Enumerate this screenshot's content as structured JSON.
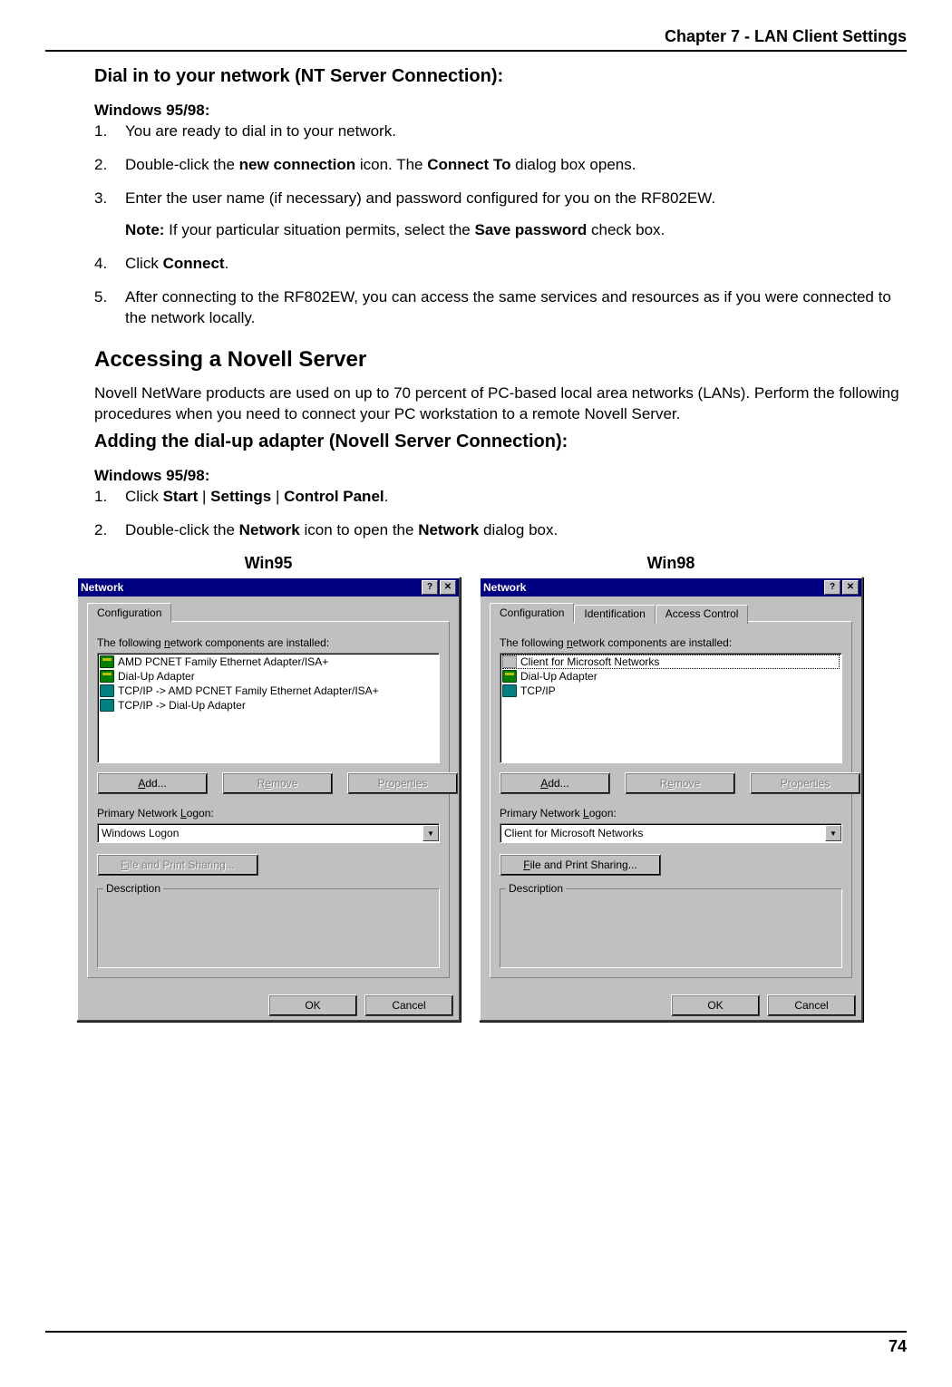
{
  "header": {
    "chapter": "Chapter 7 - LAN Client Settings"
  },
  "sections": {
    "dial_in_title": "Dial in to your network (NT Server Connection):",
    "dial_in_os": "Windows 95/98:",
    "dial_in_steps": {
      "s1": "You are ready to dial in to your network.",
      "s2a": "Double-click the ",
      "s2b": "new connection",
      "s2c": " icon.  The ",
      "s2d": "Connect To",
      "s2e": " dialog box opens.",
      "s3": "Enter the user name (if necessary) and password configured for you on the RF802EW.",
      "note_label": "Note:",
      "note_a": " If your particular situation permits, select the ",
      "note_b": "Save password",
      "note_c": " check box.",
      "s4a": "Click ",
      "s4b": "Connect",
      "s4c": ".",
      "s5": "After connecting to the RF802EW, you can access the same services and resources as if you were connected to the network locally."
    },
    "novell_title": "Accessing a Novell Server",
    "novell_text": "Novell NetWare products are used on up to 70 percent of PC-based local area networks (LANs).  Perform the following procedures when you need to connect your PC workstation to a remote Novell Server.",
    "adapter_title": "Adding the dial-up adapter (Novell Server Connection):",
    "adapter_os": "Windows 95/98:",
    "adapter_steps": {
      "s1a": "Click ",
      "s1b": "Start",
      "s1c": " | ",
      "s1d": "Settings",
      "s1e": " | ",
      "s1f": "Control Panel",
      "s1g": ".",
      "s2a": "Double-click the ",
      "s2b": "Network",
      "s2c": " icon to open the ",
      "s2d": "Network",
      "s2e": " dialog box."
    }
  },
  "captions": {
    "win95": "Win95",
    "win98": "Win98"
  },
  "dialogs": {
    "win95": {
      "title": "Network",
      "tabs": [
        "Configuration"
      ],
      "components_label_pre": "The following ",
      "components_label_u": "n",
      "components_label_post": "etwork components are installed:",
      "list": [
        "AMD PCNET Family Ethernet Adapter/ISA+",
        "Dial-Up Adapter",
        "TCP/IP -> AMD PCNET Family Ethernet Adapter/ISA+",
        "TCP/IP -> Dial-Up Adapter"
      ],
      "btn_add_u": "A",
      "btn_add_post": "dd...",
      "btn_remove_pre": "R",
      "btn_remove_u": "e",
      "btn_remove_post": "move",
      "btn_props_pre": "P",
      "btn_props_u": "r",
      "btn_props_post": "operties",
      "primary_logon_label_pre": "Primary Network ",
      "primary_logon_label_u": "L",
      "primary_logon_label_post": "ogon:",
      "primary_logon_value": "Windows Logon",
      "file_print_u": "F",
      "file_print_post": "ile and Print Sharing...",
      "description_label": "Description",
      "ok": "OK",
      "cancel": "Cancel"
    },
    "win98": {
      "title": "Network",
      "tabs": [
        "Configuration",
        "Identification",
        "Access Control"
      ],
      "components_label_pre": "The following ",
      "components_label_u": "n",
      "components_label_post": "etwork components are installed:",
      "list": [
        "Client for Microsoft Networks",
        "Dial-Up Adapter",
        "TCP/IP"
      ],
      "btn_add_u": "A",
      "btn_add_post": "dd...",
      "btn_remove_pre": "R",
      "btn_remove_u": "e",
      "btn_remove_post": "move",
      "btn_props_pre": "P",
      "btn_props_u": "r",
      "btn_props_post": "operties",
      "primary_logon_label_pre": "Primary Network ",
      "primary_logon_label_u": "L",
      "primary_logon_label_post": "ogon:",
      "primary_logon_value": "Client for Microsoft Networks",
      "file_print_u": "F",
      "file_print_post": "ile and Print Sharing...",
      "description_label": "Description",
      "ok": "OK",
      "cancel": "Cancel"
    }
  },
  "page_number": "74"
}
